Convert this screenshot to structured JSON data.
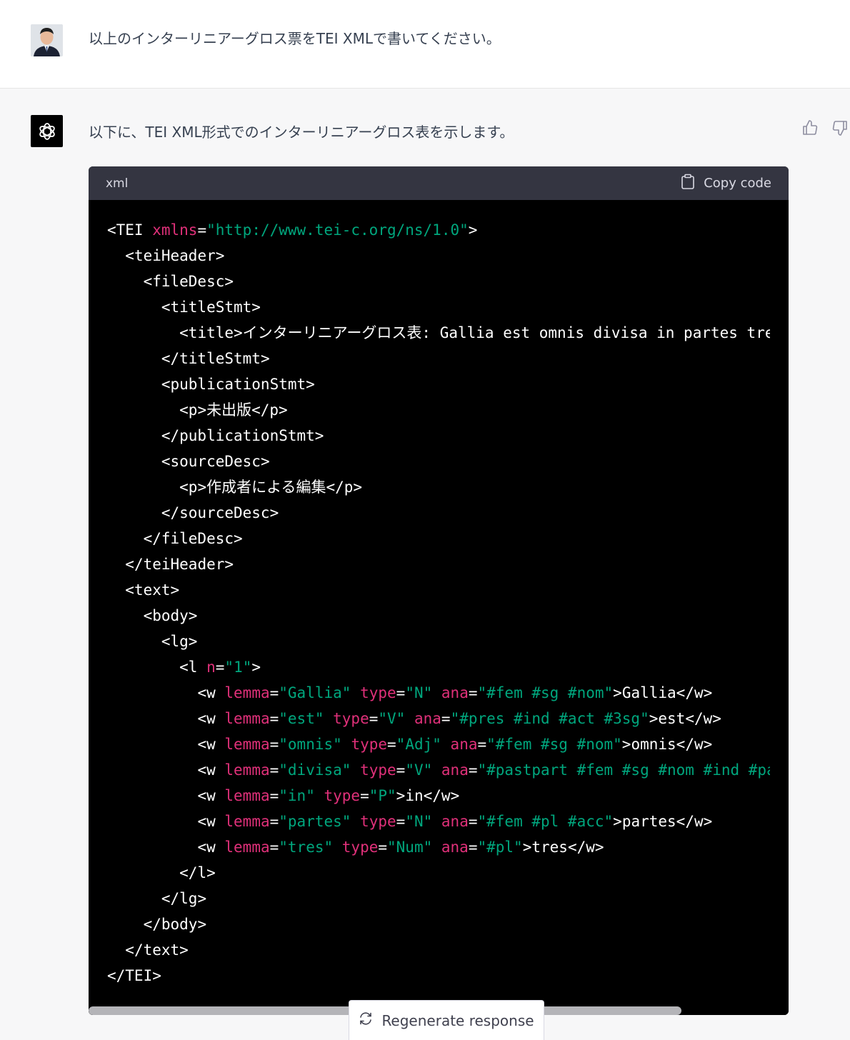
{
  "user": {
    "message": "以上のインターリニアーグロス票をTEI XMLで書いてください。",
    "avatar_icon": "user-avatar-icon"
  },
  "assistant": {
    "intro": "以下に、TEI XML形式でのインターリニアーグロス表を示します。",
    "logo_icon": "openai-logo-icon",
    "thumbs_up_icon": "thumbs-up-icon",
    "thumbs_down_icon": "thumbs-down-icon"
  },
  "code_block": {
    "language": "xml",
    "copy_label": "Copy code",
    "lines": [
      "<TEI xmlns=\"http://www.tei-c.org/ns/1.0\">",
      "  <teiHeader>",
      "    <fileDesc>",
      "      <titleStmt>",
      "        <title>インターリニアーグロス表: Gallia est omnis divisa in partes tres</title>",
      "      </titleStmt>",
      "      <publicationStmt>",
      "        <p>未出版</p>",
      "      </publicationStmt>",
      "      <sourceDesc>",
      "        <p>作成者による編集</p>",
      "      </sourceDesc>",
      "    </fileDesc>",
      "  </teiHeader>",
      "  <text>",
      "    <body>",
      "      <lg>",
      "        <l n=\"1\">",
      "          <w lemma=\"Gallia\" type=\"N\" ana=\"#fem #sg #nom\">Gallia</w>",
      "          <w lemma=\"est\" type=\"V\" ana=\"#pres #ind #act #3sg\">est</w>",
      "          <w lemma=\"omnis\" type=\"Adj\" ana=\"#fem #sg #nom\">omnis</w>",
      "          <w lemma=\"divisa\" type=\"V\" ana=\"#pastpart #fem #sg #nom #ind #pass\">divisa</w>",
      "          <w lemma=\"in\" type=\"P\">in</w>",
      "          <w lemma=\"partes\" type=\"N\" ana=\"#fem #pl #acc\">partes</w>",
      "          <w lemma=\"tres\" type=\"Num\" ana=\"#pl\">tres</w>",
      "        </l>",
      "      </lg>",
      "    </body>",
      "  </text>",
      "</TEI>"
    ],
    "colors": {
      "attr": "#df3079",
      "string": "#00a67d",
      "tag": "#ffffff"
    }
  },
  "regenerate": {
    "label": "Regenerate response",
    "icon": "refresh-icon"
  }
}
